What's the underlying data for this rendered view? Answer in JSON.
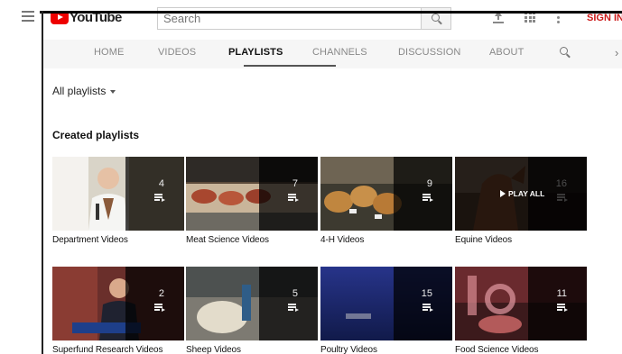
{
  "masthead": {
    "logo_text": "YouTube",
    "search_placeholder": "Search",
    "signin_label": "SIGN IN"
  },
  "tabs": [
    {
      "label": "HOME",
      "active": false
    },
    {
      "label": "VIDEOS",
      "active": false
    },
    {
      "label": "PLAYLISTS",
      "active": true
    },
    {
      "label": "CHANNELS",
      "active": false
    },
    {
      "label": "DISCUSSION",
      "active": false
    },
    {
      "label": "ABOUT",
      "active": false
    }
  ],
  "sort_label": "All playlists",
  "section_title": "Created playlists",
  "playlists": [
    {
      "title": "Department Videos",
      "count": "4"
    },
    {
      "title": "Meat Science Videos",
      "count": "7"
    },
    {
      "title": "4-H Videos",
      "count": "9"
    },
    {
      "title": "Equine Videos",
      "count": "16",
      "hover_label": "PLAY ALL"
    },
    {
      "title": "Superfund Research Videos",
      "count": "2"
    },
    {
      "title": "Sheep Videos",
      "count": "5"
    },
    {
      "title": "Poultry Videos",
      "count": "15"
    },
    {
      "title": "Food Science Videos",
      "count": "11"
    }
  ],
  "colors": {
    "brand_red": "#ee0000",
    "signin_red": "#cc1a1a",
    "tab_bar": "#f6f6f6"
  }
}
